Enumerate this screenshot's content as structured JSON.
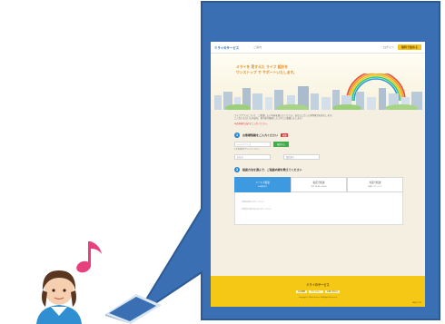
{
  "site": {
    "logo": "ミライのサービス",
    "sub": "ご案内",
    "login": "ログイン",
    "cta": "無料で始める",
    "hero_line1": "ミライを 見すえた ライフ 設計を",
    "hero_line2": "ワンストップ で サポートいたします。",
    "intro_line1": "ライフプランについて、ご相談したい内容を選んでください。あなたに合った専門家がお答えします。",
    "intro_line2": "ご入力いただいた内容は、担当者が確認したうえでご連絡いたします。",
    "note": "※必須項目は必ずご入力ください。",
    "step1_num": "1",
    "step1_title": "お客様情報をご入力ください",
    "step1_req": "必須",
    "email_placeholder": "メールアドレス",
    "send_button": "確認する",
    "step1_small": "※半角英数字でご入力ください",
    "name_placeholder": "お名前",
    "phone_placeholder": "電話番号",
    "step2_num": "2",
    "step2_title": "相談方法を選んで、ご相談内容を教えてください",
    "tabs": [
      {
        "label": "メールで相談",
        "sub": "24時間受付"
      },
      {
        "label": "電話で相談",
        "sub": "平日 10:00〜18:00"
      },
      {
        "label": "対面で相談",
        "sub": "店舗・オンライン"
      }
    ],
    "panel_line1": "ご相談内容をご記入ください",
    "panel_line2": "ご希望の日時があればご記入ください",
    "footer_logo": "ミライのサービス",
    "footer_links": [
      "会社概要",
      "プライバシー",
      "お問い合わせ"
    ],
    "copyright": "Copyright © Mirai Service. All Rights Reserved.",
    "page_top": "PAGE TOP"
  },
  "colors": {
    "bubble": "#3b6fb3",
    "note": "#e8407f",
    "footer": "#f6c816"
  }
}
